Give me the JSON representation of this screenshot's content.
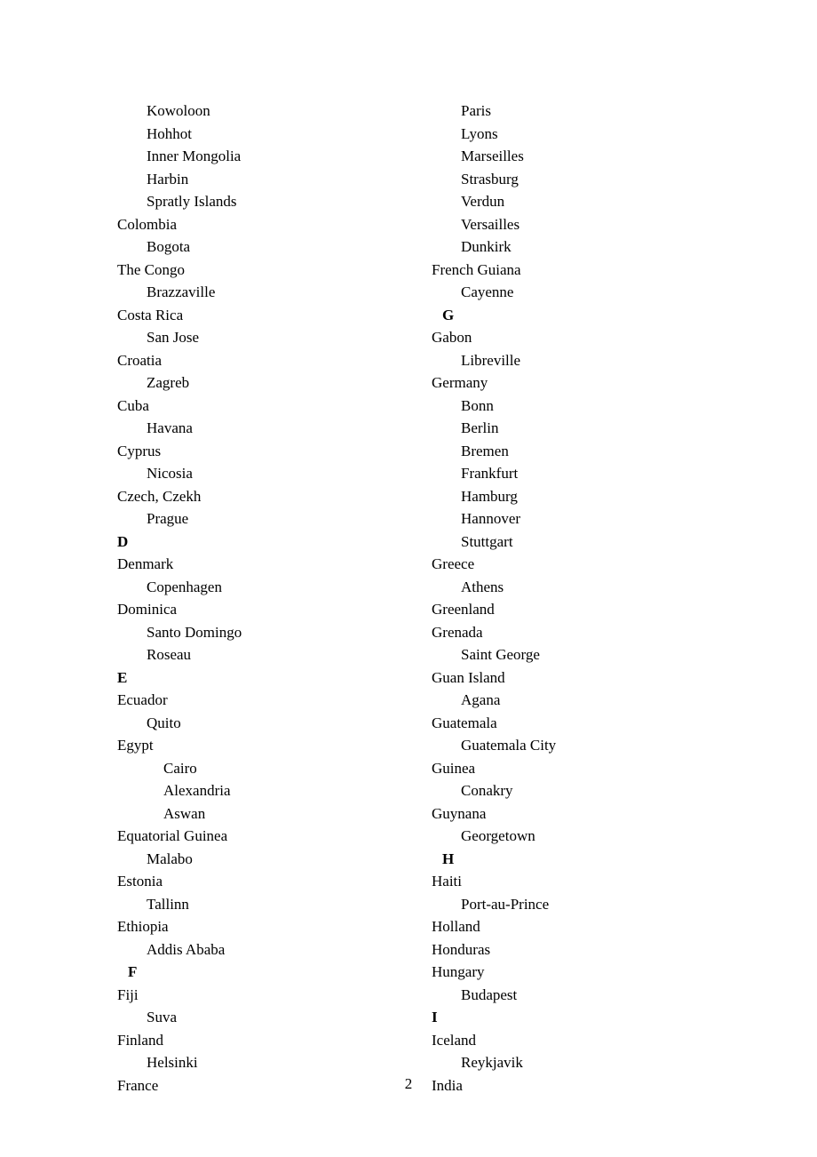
{
  "pageNumber": "2",
  "columns": [
    [
      {
        "t": "Kowoloon",
        "cls": "i1"
      },
      {
        "t": "Hohhot",
        "cls": "i1"
      },
      {
        "t": "Inner Mongolia",
        "cls": "i1"
      },
      {
        "t": "Harbin",
        "cls": "i1"
      },
      {
        "t": "Spratly Islands",
        "cls": "i1"
      },
      {
        "t": "Colombia",
        "cls": ""
      },
      {
        "t": "Bogota",
        "cls": "i1"
      },
      {
        "t": "The Congo",
        "cls": ""
      },
      {
        "t": "Brazzaville",
        "cls": "i1"
      },
      {
        "t": "Costa Rica",
        "cls": ""
      },
      {
        "t": "San Jose",
        "cls": "i1"
      },
      {
        "t": "Croatia",
        "cls": ""
      },
      {
        "t": "Zagreb",
        "cls": "i1"
      },
      {
        "t": "Cuba",
        "cls": ""
      },
      {
        "t": "Havana",
        "cls": "i1"
      },
      {
        "t": "Cyprus",
        "cls": ""
      },
      {
        "t": "Nicosia",
        "cls": "i1"
      },
      {
        "t": "Czech, Czekh",
        "cls": ""
      },
      {
        "t": "Prague",
        "cls": "i1"
      },
      {
        "t": "D",
        "cls": "b"
      },
      {
        "t": "Denmark",
        "cls": ""
      },
      {
        "t": "Copenhagen",
        "cls": "i1"
      },
      {
        "t": "Dominica",
        "cls": ""
      },
      {
        "t": "Santo Domingo",
        "cls": "i1"
      },
      {
        "t": "Roseau",
        "cls": "i1"
      },
      {
        "t": "E",
        "cls": "b"
      },
      {
        "t": "Ecuador",
        "cls": ""
      },
      {
        "t": "Quito",
        "cls": "i1"
      },
      {
        "t": "Egypt",
        "cls": ""
      },
      {
        "t": "Cairo",
        "cls": "i2"
      },
      {
        "t": "Alexandria",
        "cls": "i2"
      },
      {
        "t": "Aswan",
        "cls": "i2"
      },
      {
        "t": "Equatorial Guinea",
        "cls": ""
      },
      {
        "t": "Malabo",
        "cls": "i1"
      },
      {
        "t": "Estonia",
        "cls": ""
      },
      {
        "t": "Tallinn",
        "cls": "i1"
      },
      {
        "t": "Ethiopia",
        "cls": ""
      },
      {
        "t": "Addis Ababa",
        "cls": "i1"
      },
      {
        "t": "F",
        "cls": "b h"
      },
      {
        "t": "Fiji",
        "cls": ""
      },
      {
        "t": "Suva",
        "cls": "i1"
      },
      {
        "t": "Finland",
        "cls": ""
      },
      {
        "t": "Helsinki",
        "cls": "i1"
      },
      {
        "t": "France",
        "cls": ""
      }
    ],
    [
      {
        "t": "Paris",
        "cls": "i1"
      },
      {
        "t": "Lyons",
        "cls": "i1"
      },
      {
        "t": "Marseilles",
        "cls": "i1"
      },
      {
        "t": "Strasburg",
        "cls": "i1"
      },
      {
        "t": "Verdun",
        "cls": "i1"
      },
      {
        "t": "Versailles",
        "cls": "i1"
      },
      {
        "t": "Dunkirk",
        "cls": "i1"
      },
      {
        "t": "French Guiana",
        "cls": ""
      },
      {
        "t": "Cayenne",
        "cls": "i1"
      },
      {
        "t": "G",
        "cls": "b h"
      },
      {
        "t": "Gabon",
        "cls": ""
      },
      {
        "t": "Libreville",
        "cls": "i1"
      },
      {
        "t": "Germany",
        "cls": ""
      },
      {
        "t": "Bonn",
        "cls": "i1"
      },
      {
        "t": "Berlin",
        "cls": "i1"
      },
      {
        "t": "Bremen",
        "cls": "i1"
      },
      {
        "t": "Frankfurt",
        "cls": "i1"
      },
      {
        "t": "Hamburg",
        "cls": "i1"
      },
      {
        "t": "Hannover",
        "cls": "i1"
      },
      {
        "t": "Stuttgart",
        "cls": "i1"
      },
      {
        "t": "Greece",
        "cls": ""
      },
      {
        "t": "Athens",
        "cls": "i1"
      },
      {
        "t": "Greenland",
        "cls": ""
      },
      {
        "t": "Grenada",
        "cls": ""
      },
      {
        "t": "Saint George",
        "cls": "i1"
      },
      {
        "t": "Guan Island",
        "cls": ""
      },
      {
        "t": "Agana",
        "cls": "i1"
      },
      {
        "t": "Guatemala",
        "cls": ""
      },
      {
        "t": "Guatemala City",
        "cls": "i1"
      },
      {
        "t": "Guinea",
        "cls": ""
      },
      {
        "t": "Conakry",
        "cls": "i1"
      },
      {
        "t": "Guynana",
        "cls": ""
      },
      {
        "t": "Georgetown",
        "cls": "i1"
      },
      {
        "t": "H",
        "cls": "b h"
      },
      {
        "t": "Haiti",
        "cls": ""
      },
      {
        "t": "Port-au-Prince",
        "cls": "i1"
      },
      {
        "t": "Holland",
        "cls": ""
      },
      {
        "t": "Honduras",
        "cls": ""
      },
      {
        "t": "Hungary",
        "cls": ""
      },
      {
        "t": "Budapest",
        "cls": "i1"
      },
      {
        "t": "I",
        "cls": "b"
      },
      {
        "t": "Iceland",
        "cls": ""
      },
      {
        "t": "Reykjavik",
        "cls": "i1"
      },
      {
        "t": "India",
        "cls": ""
      }
    ]
  ]
}
